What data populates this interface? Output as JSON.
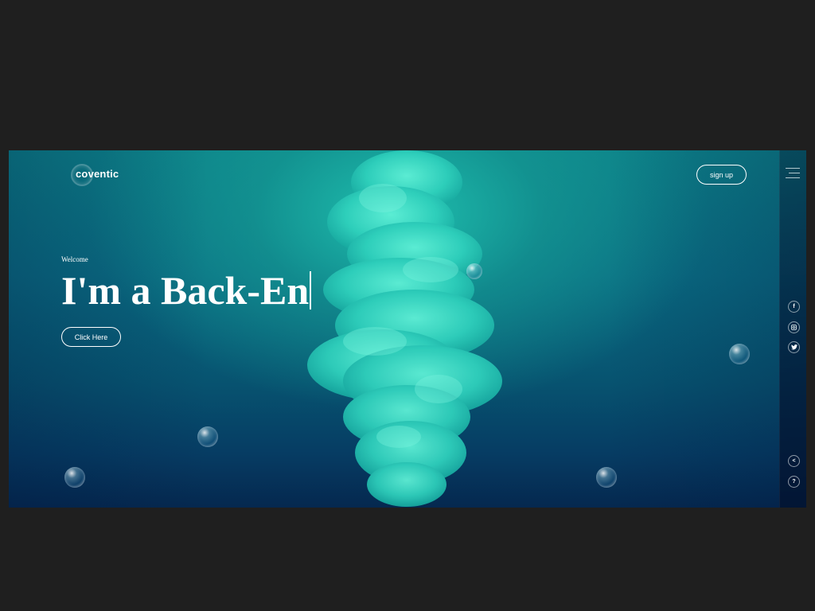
{
  "header": {
    "logo_text": "coventic",
    "signup_label": "sign up"
  },
  "hero": {
    "eyebrow": "Welcome",
    "headline": "I'm a Back-En",
    "cta_label": "Click Here"
  },
  "side_rail": {
    "social": [
      {
        "icon": "facebook-icon",
        "glyph": "f"
      },
      {
        "icon": "instagram-icon",
        "glyph": "◎"
      },
      {
        "icon": "twitter-icon",
        "glyph": "🐦"
      }
    ],
    "share_glyph": "<",
    "help_glyph": "?"
  },
  "colors": {
    "page_background": "#1f1f1f",
    "accent_teal": "#1fbfae",
    "deep_blue": "#05284f"
  }
}
